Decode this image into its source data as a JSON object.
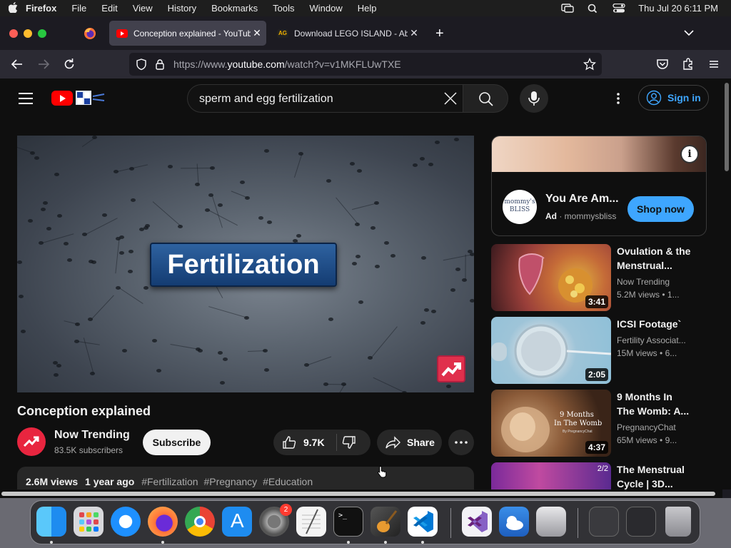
{
  "menubar": {
    "app_name": "Firefox",
    "items": [
      "File",
      "Edit",
      "View",
      "History",
      "Bookmarks",
      "Tools",
      "Window",
      "Help"
    ],
    "clock": "Thu Jul 20  6:11 PM"
  },
  "browser": {
    "tabs": [
      {
        "title": "Conception explained - YouTube",
        "icon": "youtube-favicon"
      },
      {
        "title": "Download LEGO ISLAND - Aband",
        "icon": "ag-favicon"
      }
    ],
    "url_prefix": "https://www.",
    "url_domain": "youtube.com",
    "url_path": "/watch?v=v1MKFLUwTXE"
  },
  "youtube": {
    "search_query": "sperm and egg fertilization",
    "sign_in_label": "Sign in",
    "accent_color": "#3ea6ff",
    "brand_color": "#ff0000"
  },
  "video": {
    "overlay_title": "Fertilization",
    "title": "Conception explained",
    "channel": "Now Trending",
    "subscribers": "83.5K subscribers",
    "subscribe_label": "Subscribe",
    "likes": "9.7K",
    "share_label": "Share",
    "views": "2.6M views",
    "age": "1 year ago",
    "hashtags": [
      "#Fertilization",
      "#Pregnancy",
      "#Education"
    ]
  },
  "ad": {
    "logo_text": "mommy's BLISS",
    "title": "You Are Am...",
    "ad_label": "Ad",
    "advertiser": "mommysbliss",
    "cta": "Shop now"
  },
  "recommendations": [
    {
      "title_line1": "Ovulation & the",
      "title_line2": "Menstrual...",
      "channel": "Now Trending",
      "views": "5.2M views",
      "age": "1...",
      "duration": "3:41"
    },
    {
      "title_line1": "ICSI Footage`",
      "title_line2": "",
      "channel": "Fertility Associat...",
      "views": "15M views",
      "age": "6...",
      "duration": "2:05"
    },
    {
      "title_line1": "9 Months In",
      "title_line2": "The Womb: A...",
      "channel": "PregnancyChat",
      "views": "65M views",
      "age": "9...",
      "duration": "4:37",
      "thumb_text_1": "9 Months",
      "thumb_text_2": "In The Womb",
      "thumb_text_3": "By PregnancyChat"
    },
    {
      "title_line1": "The Menstrual",
      "title_line2": "Cycle | 3D...",
      "channel": "",
      "views": "",
      "age": "",
      "duration": "",
      "badge": "2/2"
    }
  ],
  "dock": {
    "apps": [
      "Finder",
      "Launchpad",
      "Safari",
      "Firefox",
      "Chrome",
      "App Store",
      "System Settings",
      "TextEdit",
      "Terminal",
      "GarageBand",
      "VS Code",
      "Visual Studio",
      "Weather",
      "Disk Utility",
      "Recent 1",
      "Recent 2",
      "Trash"
    ],
    "settings_badge": "2"
  }
}
